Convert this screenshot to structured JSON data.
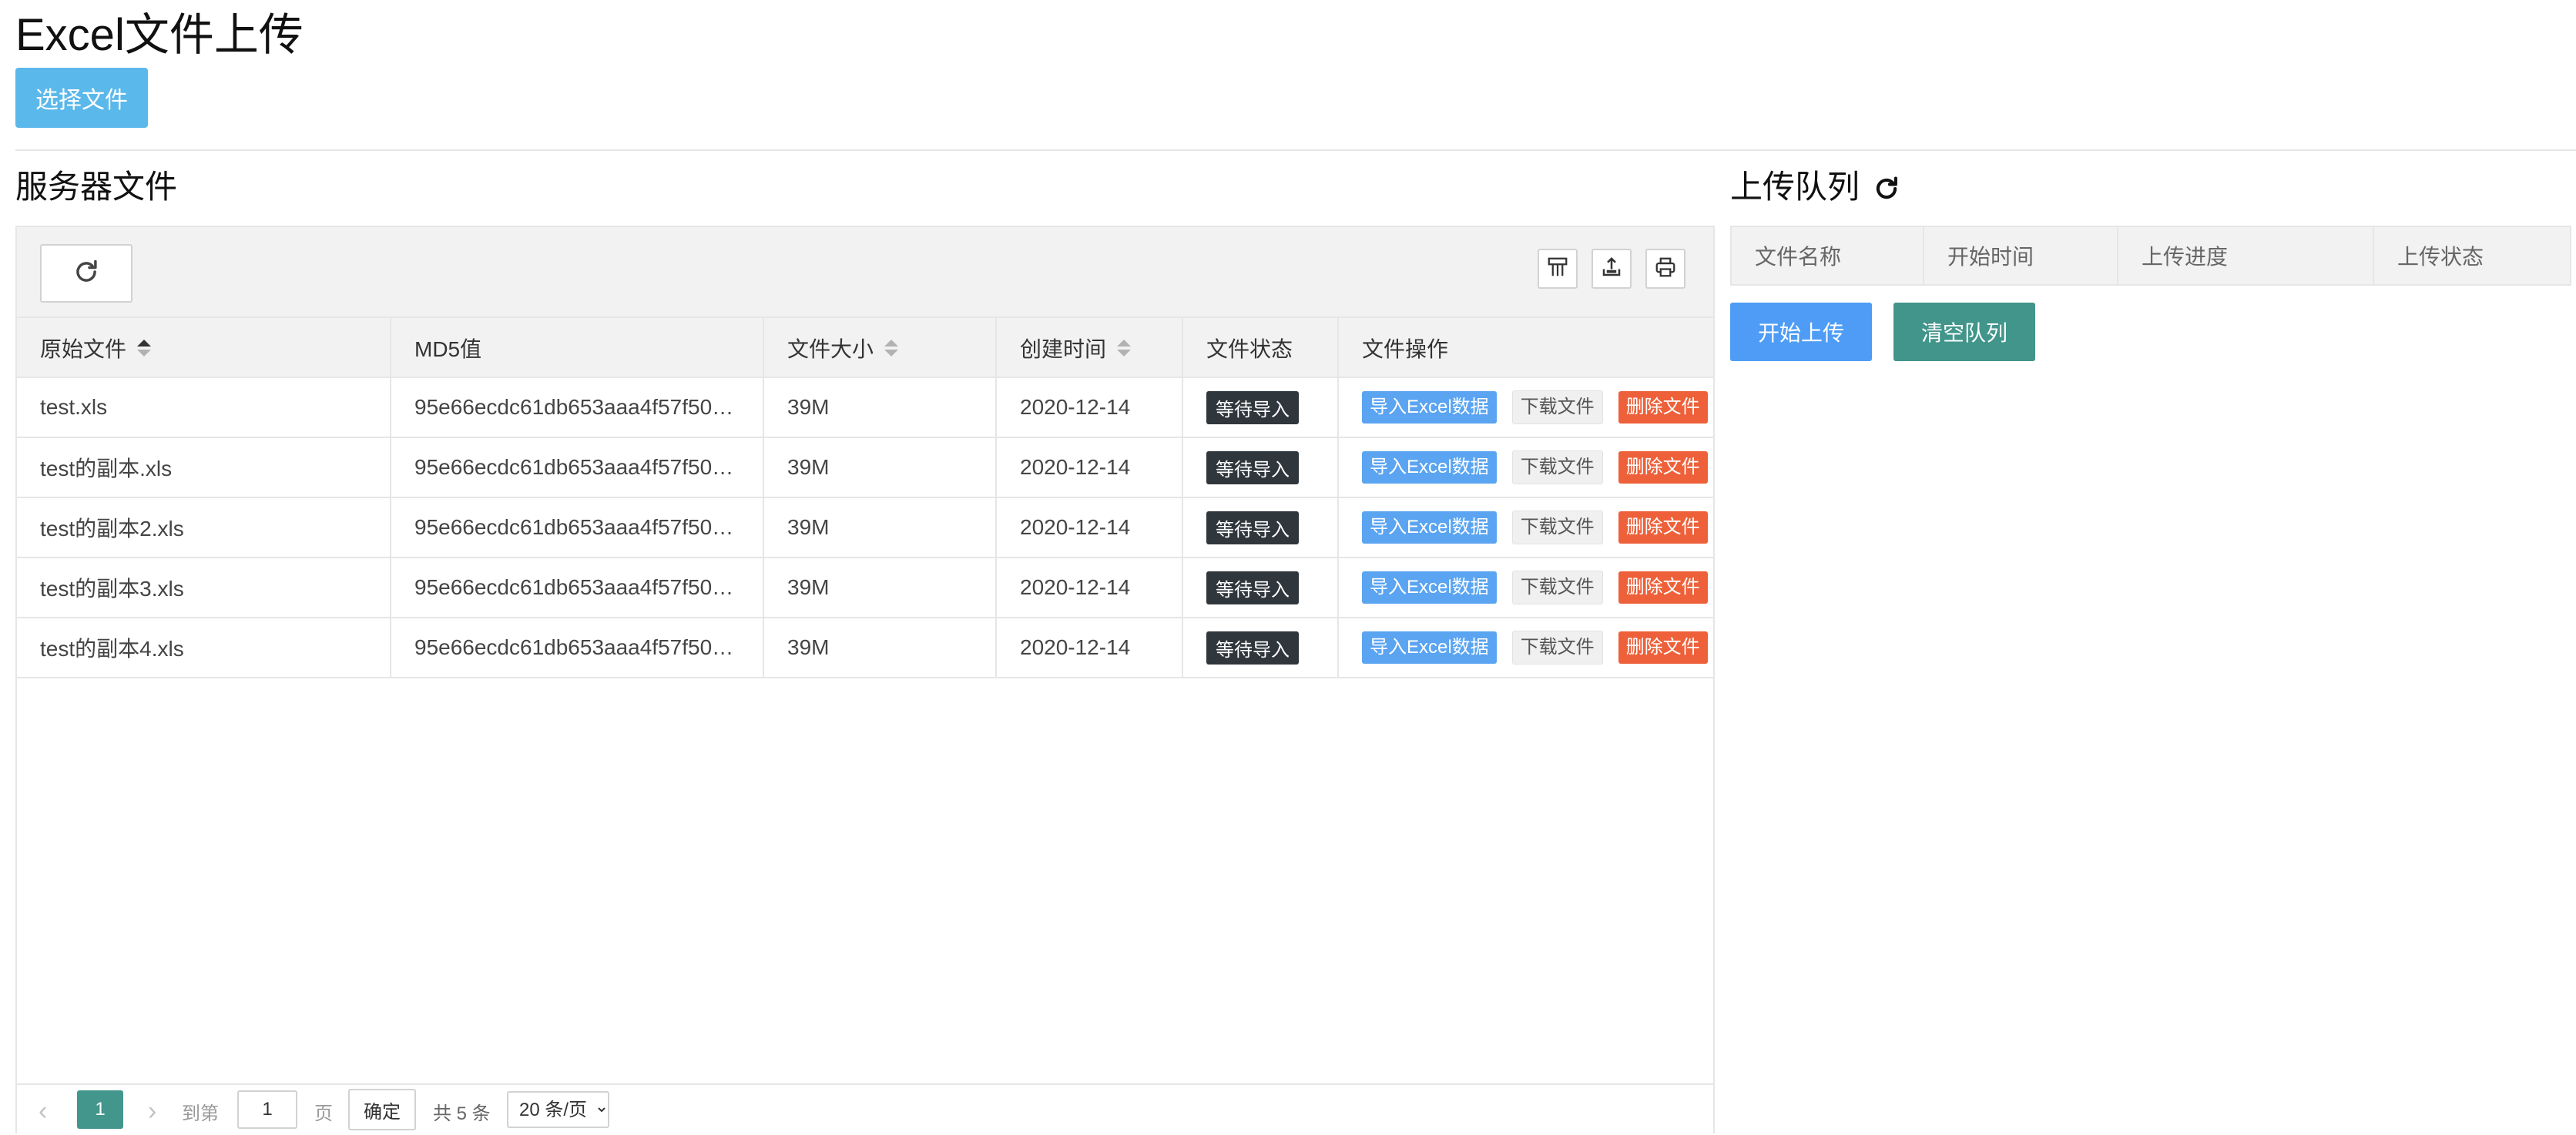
{
  "header": {
    "title": "Excel文件上传",
    "choose_file_label": "选择文件"
  },
  "server": {
    "title": "服务器文件",
    "toolbar_icons": [
      "refresh-icon",
      "columns-icon",
      "export-icon",
      "print-icon"
    ],
    "columns": [
      "原始文件",
      "MD5值",
      "文件大小",
      "创建时间",
      "文件状态",
      "文件操作"
    ],
    "sorted_column": "原始文件",
    "rows": [
      {
        "name": "test.xls",
        "md5": "95e66ecdc61db653aaa4f57f50…",
        "size": "39M",
        "created": "2020-12-14",
        "status": "等待导入"
      },
      {
        "name": "test的副本.xls",
        "md5": "95e66ecdc61db653aaa4f57f50…",
        "size": "39M",
        "created": "2020-12-14",
        "status": "等待导入"
      },
      {
        "name": "test的副本2.xls",
        "md5": "95e66ecdc61db653aaa4f57f50…",
        "size": "39M",
        "created": "2020-12-14",
        "status": "等待导入"
      },
      {
        "name": "test的副本3.xls",
        "md5": "95e66ecdc61db653aaa4f57f50…",
        "size": "39M",
        "created": "2020-12-14",
        "status": "等待导入"
      },
      {
        "name": "test的副本4.xls",
        "md5": "95e66ecdc61db653aaa4f57f50…",
        "size": "39M",
        "created": "2020-12-14",
        "status": "等待导入"
      }
    ],
    "actions": {
      "import": "导入Excel数据",
      "download": "下载文件",
      "delete": "删除文件"
    },
    "pager": {
      "goto_label": "到第",
      "current_page": "1",
      "page_input_value": "1",
      "page_unit": "页",
      "confirm": "确定",
      "total": "共 5 条",
      "page_size": "20 条/页"
    }
  },
  "queue": {
    "title": "上传队列",
    "columns": [
      "文件名称",
      "开始时间",
      "上传进度",
      "上传状态"
    ],
    "start_label": "开始上传",
    "clear_label": "清空队列"
  },
  "colors": {
    "primary_blue": "#5bb8ea",
    "import_blue": "#5aa4f1",
    "delete_orange": "#ee6039",
    "teal": "#41958a",
    "status_dark": "#2f363c"
  }
}
